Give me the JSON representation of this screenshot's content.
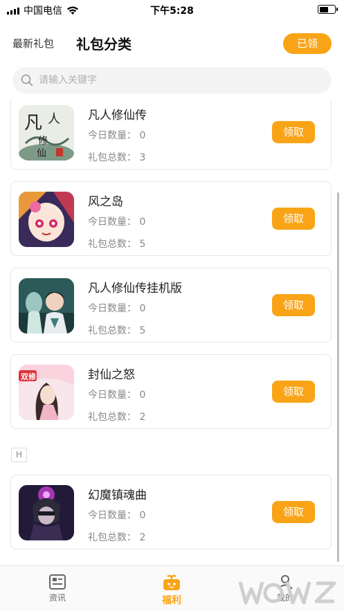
{
  "status_bar": {
    "carrier": "中国电信",
    "time": "下午5:28",
    "battery_level": 0.6
  },
  "header": {
    "tab_latest": "最新礼包",
    "tab_category": "礼包分类",
    "claimed_button": "已领"
  },
  "search": {
    "placeholder": "请输入关键字"
  },
  "labels": {
    "today_prefix": "今日数量：",
    "total_prefix": "礼包总数："
  },
  "games": [
    {
      "name": "凡人修仙传",
      "today": "今日数量： 0",
      "total": "礼包总数： 3",
      "claim": "领取",
      "icon": "fanren-xiuxian-icon"
    },
    {
      "name": "风之岛",
      "today": "今日数量： 0",
      "total": "礼包总数： 5",
      "claim": "领取",
      "icon": "fengzhidao-icon"
    },
    {
      "name": "凡人修仙传挂机版",
      "today": "今日数量： 0",
      "total": "礼包总数： 5",
      "claim": "领取",
      "icon": "fanren-guaji-icon"
    },
    {
      "name": "封仙之怒",
      "today": "今日数量： 0",
      "total": "礼包总数： 2",
      "claim": "领取",
      "icon": "fengxian-icon"
    },
    {
      "name": "幻魔镇魂曲",
      "today": "今日数量： 0",
      "total": "礼包总数： 2",
      "claim": "领取",
      "icon": "huanmo-icon"
    }
  ],
  "section_index": "H",
  "bottom_nav": {
    "news": "资讯",
    "welfare": "福利",
    "mine": "我的"
  },
  "colors": {
    "accent": "#f9a417"
  }
}
